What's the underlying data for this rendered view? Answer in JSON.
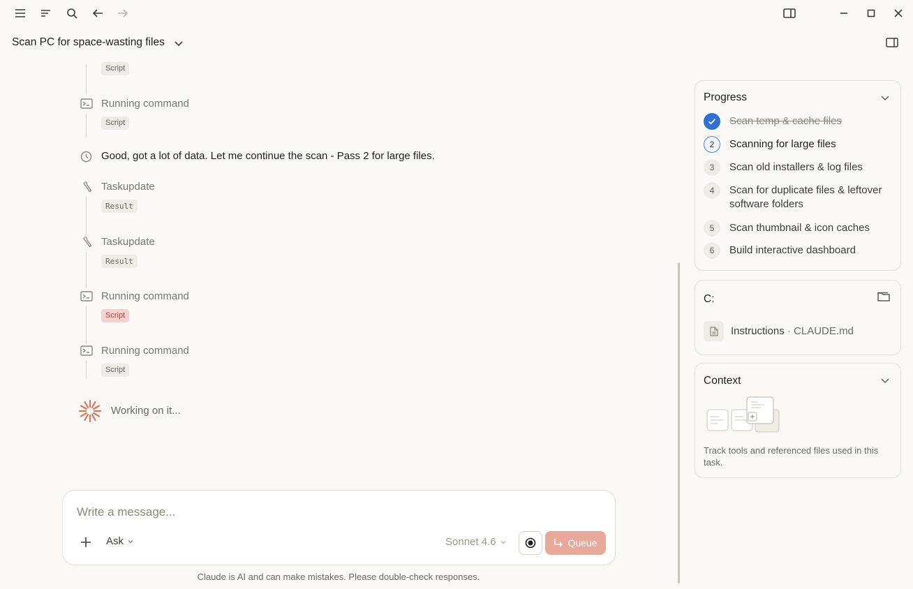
{
  "header": {
    "chat_title": "Scan PC for space-wasting files"
  },
  "timeline": {
    "items": [
      {
        "kind": "chip",
        "chip": "Script"
      },
      {
        "kind": "tool",
        "label": "Running command",
        "chip": "Script",
        "icon": "terminal-icon"
      },
      {
        "kind": "message",
        "text": "Good, got a lot of data. Let me continue the scan - Pass 2 for large files.",
        "icon": "clock-icon"
      },
      {
        "kind": "tool",
        "label": "Taskupdate",
        "chip": "Result",
        "icon": "wrench-icon"
      },
      {
        "kind": "tool",
        "label": "Taskupdate",
        "chip": "Result",
        "icon": "wrench-icon"
      },
      {
        "kind": "tool",
        "label": "Running command",
        "chip": "Script",
        "icon": "terminal-icon",
        "error": true
      },
      {
        "kind": "tool",
        "label": "Running command",
        "chip": "Script",
        "icon": "terminal-icon"
      }
    ],
    "working_text": "Working on it..."
  },
  "composer": {
    "placeholder": "Write a message...",
    "mode_label": "Ask",
    "model_label": "Sonnet 4.6",
    "queue_label": "Queue"
  },
  "disclaimer": "Claude is AI and can make mistakes. Please double-check responses.",
  "progress": {
    "title": "Progress",
    "steps": [
      {
        "num": "",
        "label": "Scan temp & cache files",
        "state": "done"
      },
      {
        "num": "2",
        "label": "Scanning for large files",
        "state": "active"
      },
      {
        "num": "3",
        "label": "Scan old installers & log files",
        "state": "pending"
      },
      {
        "num": "4",
        "label": "Scan for duplicate files & leftover software folders",
        "state": "pending"
      },
      {
        "num": "5",
        "label": "Scan thumbnail & icon caches",
        "state": "pending"
      },
      {
        "num": "6",
        "label": "Build interactive dashboard",
        "state": "pending"
      }
    ]
  },
  "folder": {
    "title": "C:",
    "file_name": "Instructions",
    "file_sep": " · ",
    "file_path": "CLAUDE.md"
  },
  "context": {
    "title": "Context",
    "description": "Track tools and referenced files used in this task."
  },
  "colors": {
    "accent": "#2f6fd6",
    "queue": "#e8a89a",
    "spinner": "#d9775a",
    "error_chip": "#f5d2cf"
  }
}
